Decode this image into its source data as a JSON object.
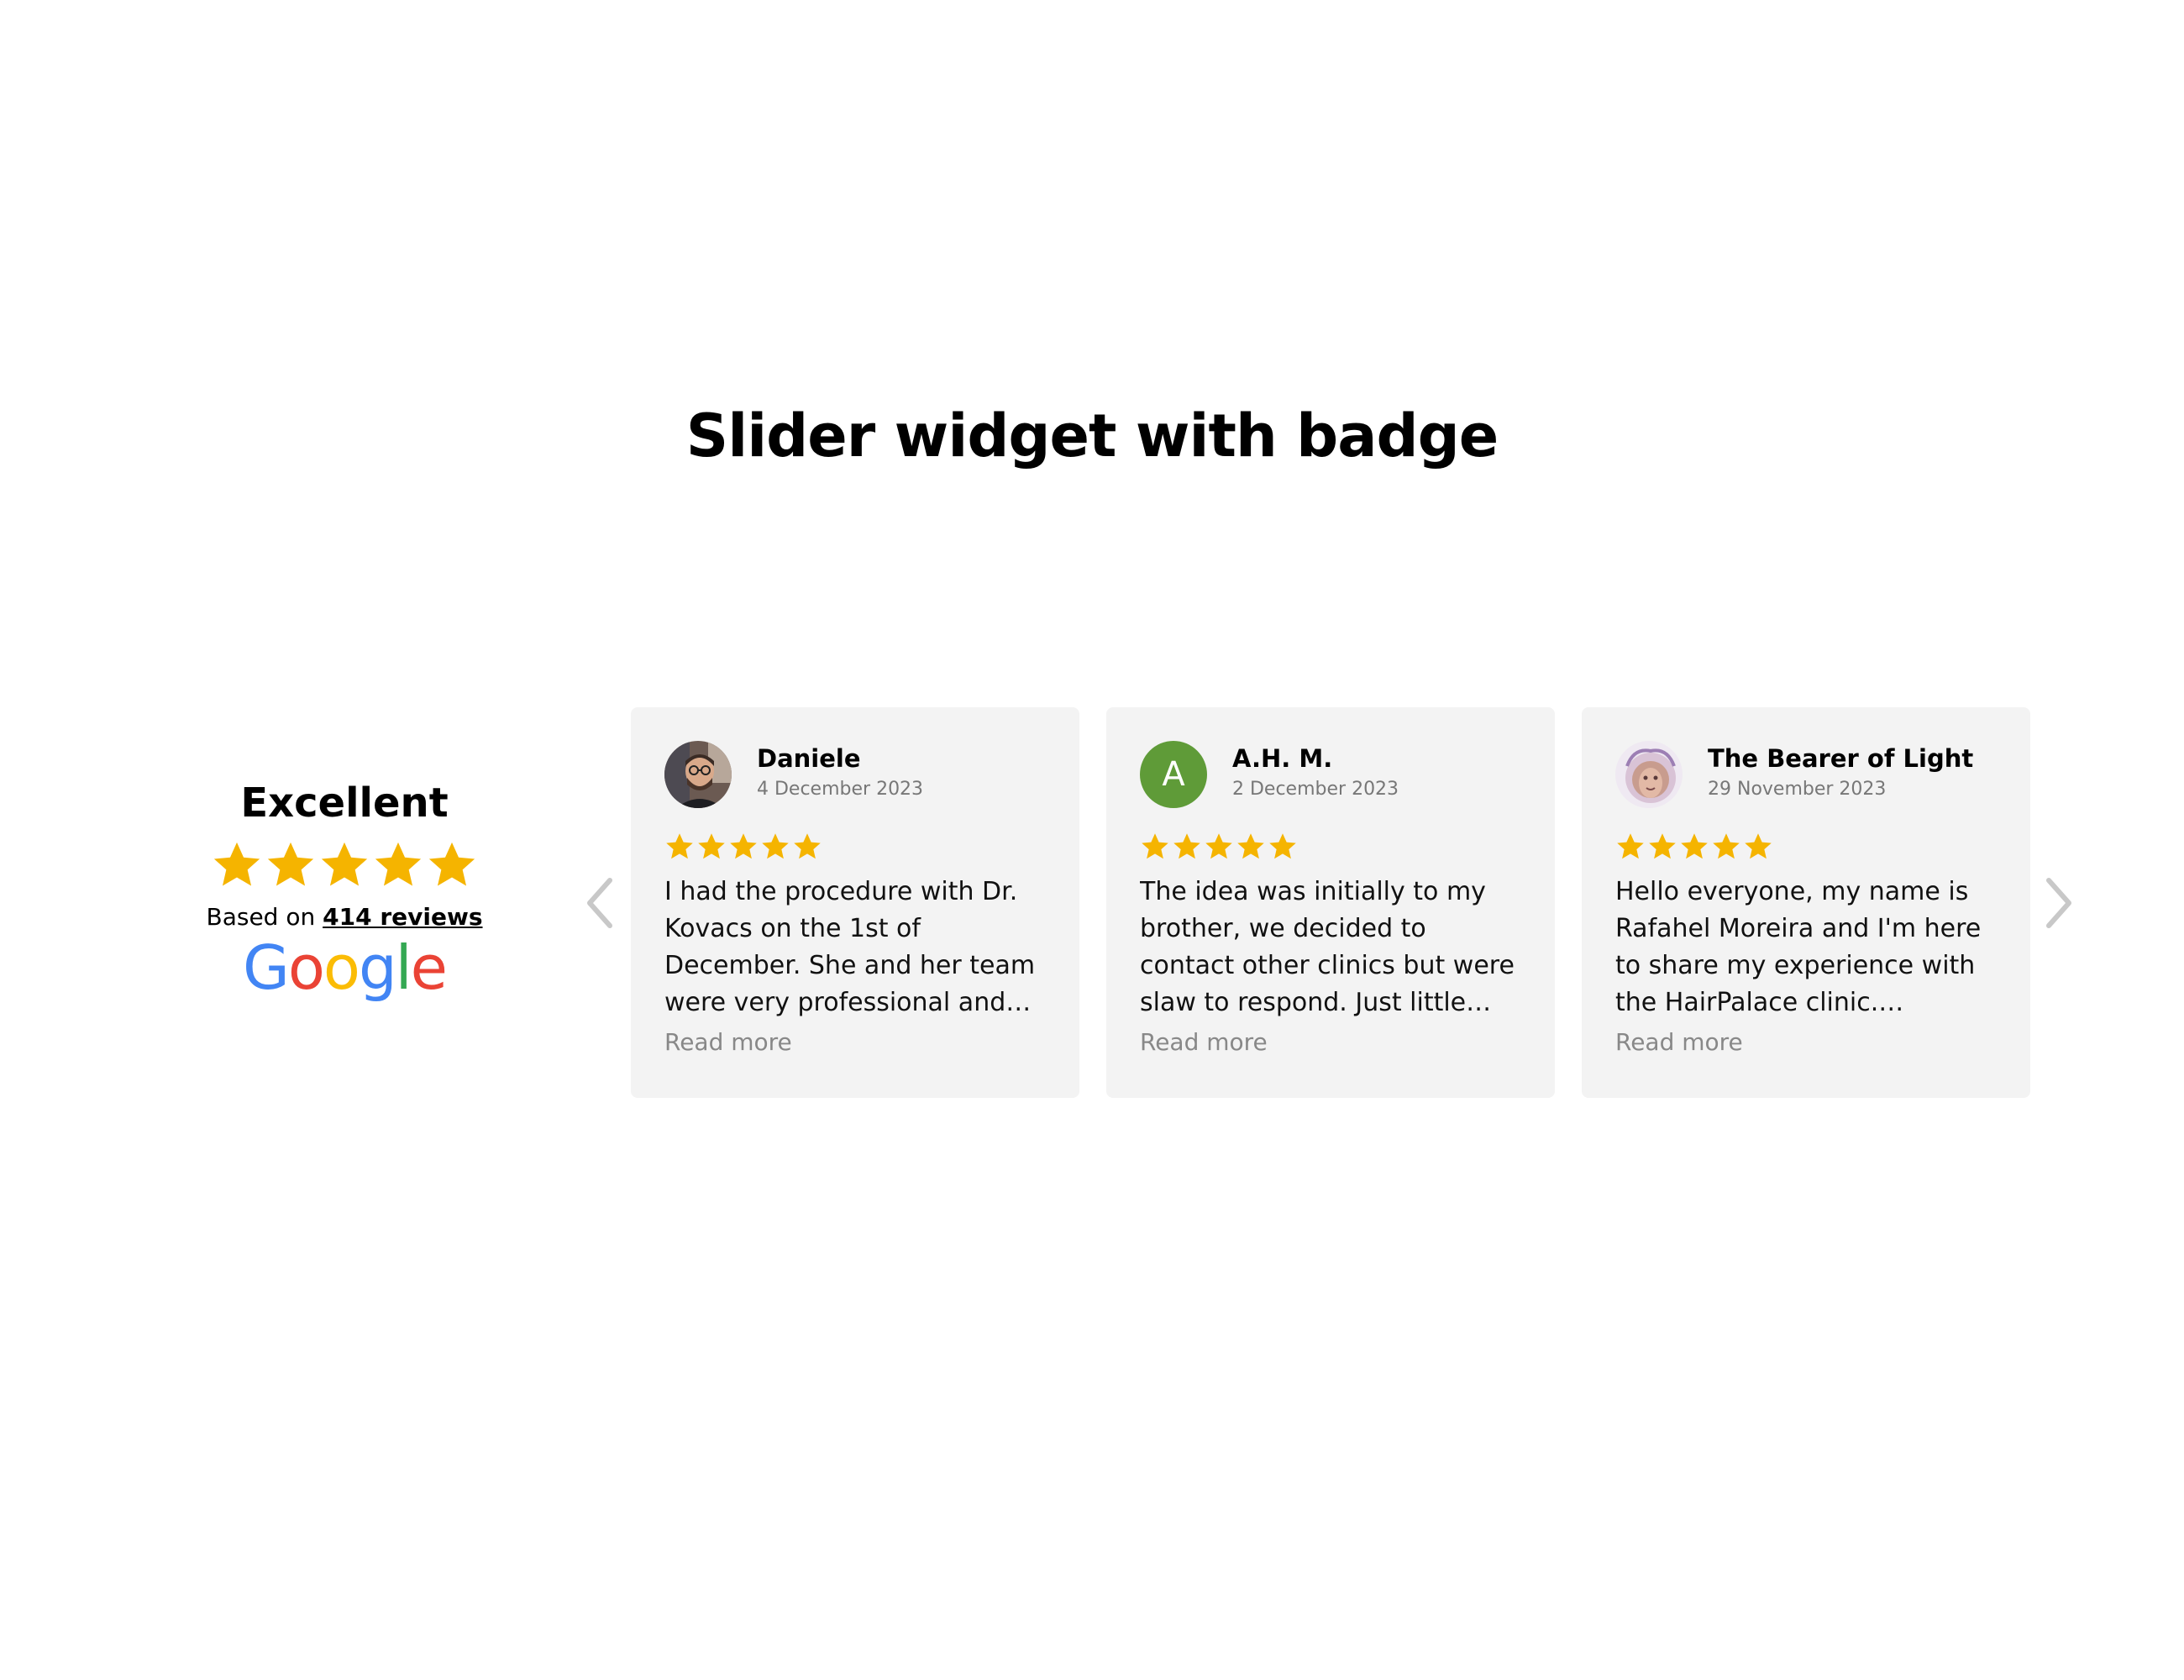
{
  "page": {
    "title": "Slider widget with badge"
  },
  "badge": {
    "rating_label": "Excellent",
    "stars": 5,
    "based_on_prefix": "Based on ",
    "reviews_link": "414 reviews",
    "logo_text": "Google",
    "logo_colors": [
      "#4285F4",
      "#EA4335",
      "#FBBC05",
      "#4285F4",
      "#34A853",
      "#EA4335"
    ]
  },
  "colors": {
    "star": "#F5B400",
    "card_bg": "#f3f3f3",
    "avatar_green": "#5f9b38",
    "arrow": "#c8c8c8"
  },
  "slider": {
    "prev_icon": "chevron-left-icon",
    "next_icon": "chevron-right-icon",
    "reviews": [
      {
        "author": "Daniele",
        "date": "4 December 2023",
        "stars": 5,
        "avatar": "photo",
        "text": "I had the procedure with Dr. Kovacs on the 1st of December. She and her team were very professional and cared about…",
        "read_more": "Read more"
      },
      {
        "author": "A.H. M.",
        "date": "2 December 2023",
        "stars": 5,
        "avatar_letter": "A",
        "text": "The idea was initially to my brother, we decided to contact other clinics but were slaw to respond. Just little search on…",
        "read_more": "Read more"
      },
      {
        "author": "The Bearer of Light",
        "date": "29 November 2023",
        "stars": 5,
        "avatar": "photo",
        "text": "Hello everyone, my name is Rafahel Moreira and I'm here to share my experience with the HairPalace clinic.…",
        "read_more": "Read more"
      }
    ]
  }
}
